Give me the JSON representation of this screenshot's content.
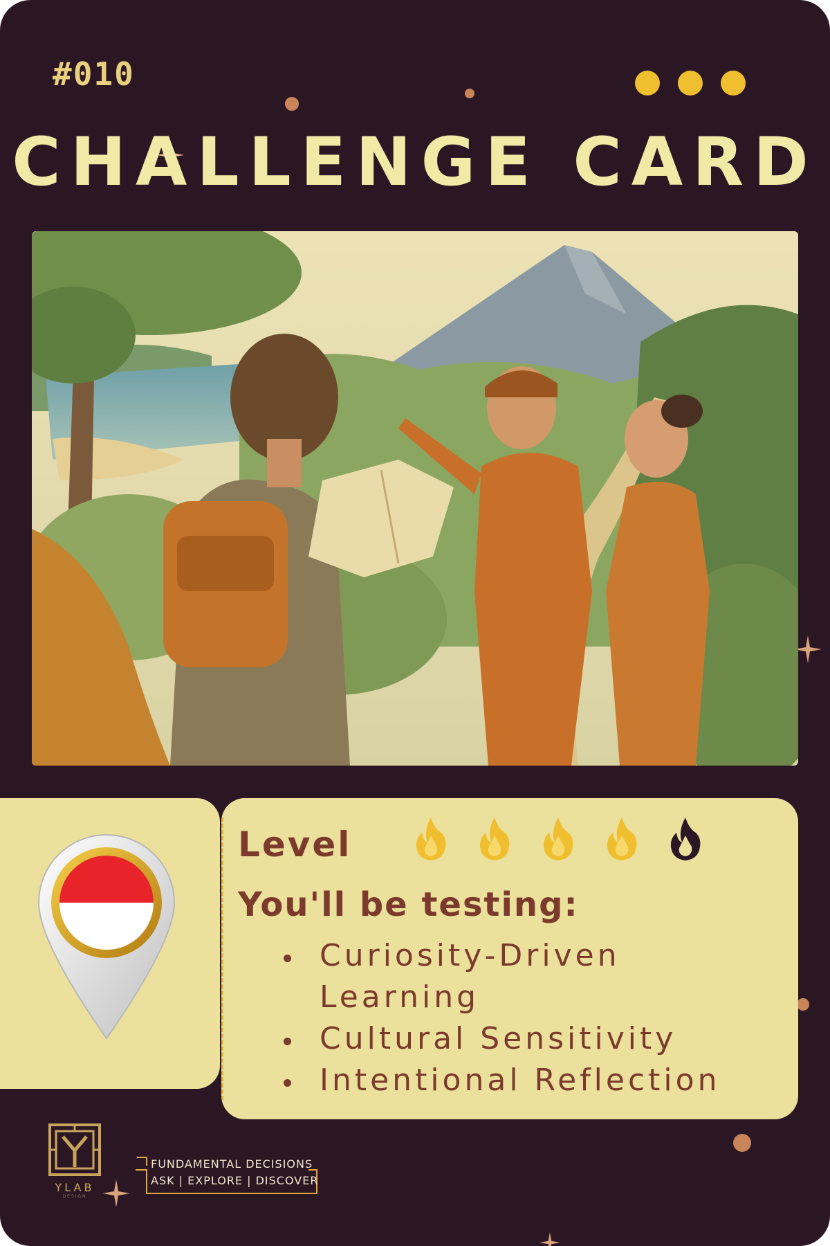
{
  "card": {
    "number": "#010",
    "title": "CHALLENGE CARD",
    "colors": {
      "background": "#2b1724",
      "panel": "#ebe09c",
      "accent_gold": "#f0bf2f",
      "text_brown": "#7b3a2c"
    }
  },
  "illustration": {
    "icon": "watercolor-illustration-traveler-asking-directions"
  },
  "location": {
    "icon": "map-pin-icon",
    "flag": "indonesia-flag-icon"
  },
  "level": {
    "label": "Level",
    "value": 4,
    "max": 5,
    "icon": "flame-icon"
  },
  "testing": {
    "label": "You'll be testing:",
    "skills": [
      "Curiosity-Driven Learning",
      "Cultural Sensitivity",
      "Intentional Reflection"
    ]
  },
  "footer": {
    "logo_text": "YLAB",
    "logo_subtext": "DESIGN",
    "tagline_line1": "FUNDAMENTAL DECISIONS",
    "tagline_line2": "ASK | EXPLORE | DISCOVER"
  }
}
